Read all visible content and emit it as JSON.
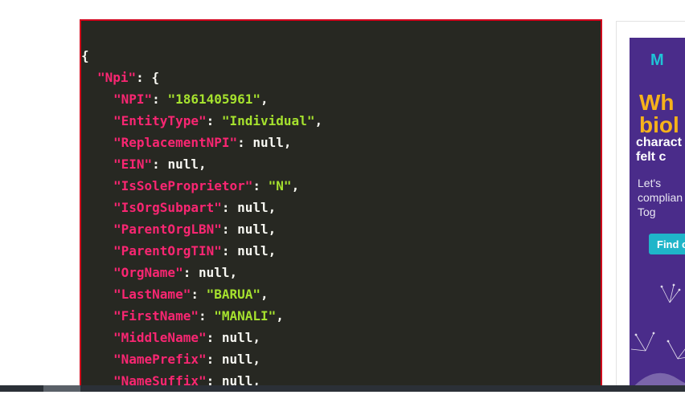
{
  "json_view": {
    "lines": {
      "open": "{",
      "npi_key": "\"Npi\"",
      "npi_open": ": {",
      "rows": [
        {
          "key": "\"NPI\"",
          "value": "\"1861405961\"",
          "type": "str"
        },
        {
          "key": "\"EntityType\"",
          "value": "\"Individual\"",
          "type": "str"
        },
        {
          "key": "\"ReplacementNPI\"",
          "value": "null",
          "type": "null"
        },
        {
          "key": "\"EIN\"",
          "value": "null",
          "type": "null"
        },
        {
          "key": "\"IsSoleProprietor\"",
          "value": "\"N\"",
          "type": "str"
        },
        {
          "key": "\"IsOrgSubpart\"",
          "value": "null",
          "type": "null"
        },
        {
          "key": "\"ParentOrgLBN\"",
          "value": "null",
          "type": "null"
        },
        {
          "key": "\"ParentOrgTIN\"",
          "value": "null",
          "type": "null"
        },
        {
          "key": "\"OrgName\"",
          "value": "null",
          "type": "null"
        },
        {
          "key": "\"LastName\"",
          "value": "\"BARUA\"",
          "type": "str"
        },
        {
          "key": "\"FirstName\"",
          "value": "\"MANALI\"",
          "type": "str"
        },
        {
          "key": "\"MiddleName\"",
          "value": "null",
          "type": "null"
        },
        {
          "key": "\"NamePrefix\"",
          "value": "null",
          "type": "null"
        },
        {
          "key": "\"NameSuffix\"",
          "value": "null",
          "type": "null"
        }
      ]
    },
    "colors": {
      "background": "#272822",
      "key": "#f92672",
      "string": "#a6e22e",
      "text": "#f8f8f2",
      "border": "#d0021b"
    }
  },
  "ad": {
    "logo": "M",
    "headline": "Wh\nbiol",
    "subhead": "charact\nfelt c",
    "body": "Let's\ncomplian\nTog",
    "button_label": "Find c",
    "colors": {
      "background": "#4a2c8a",
      "headline": "#f6b21b",
      "button": "#1fb5c9"
    }
  }
}
